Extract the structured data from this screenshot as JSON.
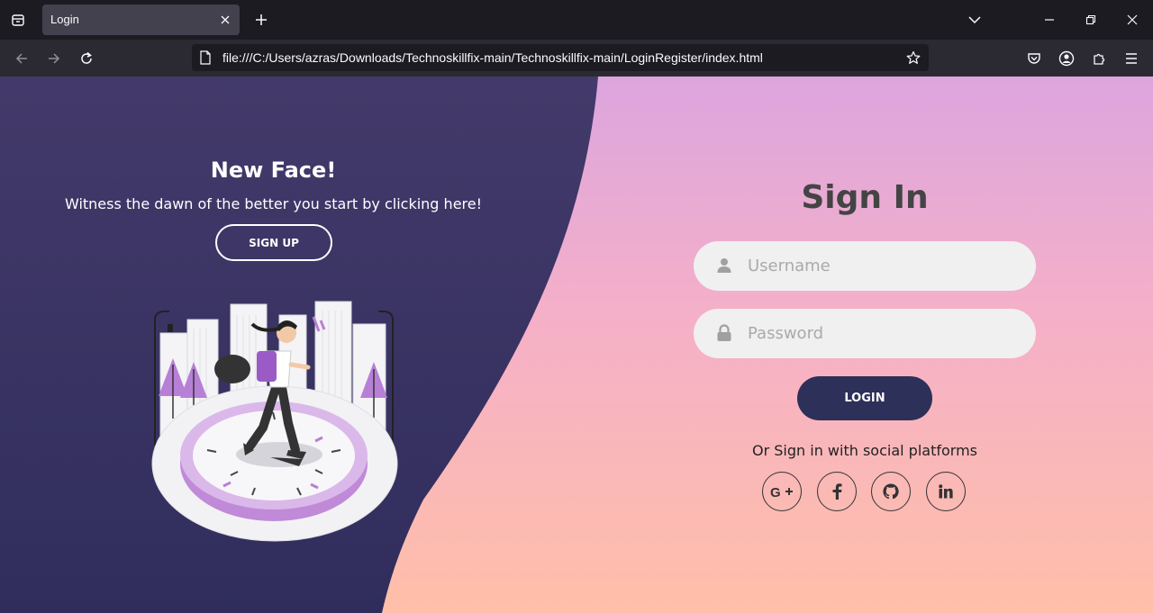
{
  "browser": {
    "tab": {
      "title": "Login"
    },
    "url": "file:///C:/Users/azras/Downloads/Technoskillfix-main/Technoskillfix-main/LoginRegister/index.html",
    "icons": [
      "tabs-overview-icon",
      "close-tab-icon",
      "new-tab-icon",
      "list-all-tabs-icon",
      "minimize-icon",
      "restore-icon",
      "close-window-icon",
      "back-icon",
      "forward-icon",
      "reload-icon",
      "page-icon",
      "bookmark-star-icon",
      "pocket-icon",
      "account-icon",
      "extensions-icon",
      "menu-icon"
    ]
  },
  "left": {
    "title": "New Face!",
    "text": "Witness the dawn of the better you start by clicking here!",
    "signup_label": "SIGN UP"
  },
  "right": {
    "title": "Sign In",
    "username_placeholder": "Username",
    "password_placeholder": "Password",
    "login_label": "LOGIN",
    "social_text": "Or Sign in with social platforms",
    "social": [
      "google-plus",
      "facebook",
      "github",
      "linkedin"
    ]
  },
  "colors": {
    "panel_dark": "#3a3566",
    "button_dark": "#2d3059",
    "gradient_top": "#dca5de",
    "gradient_mid": "#f5b0c8",
    "gradient_bottom": "#ffbfa8",
    "accent_purple": "#b87fd6"
  }
}
